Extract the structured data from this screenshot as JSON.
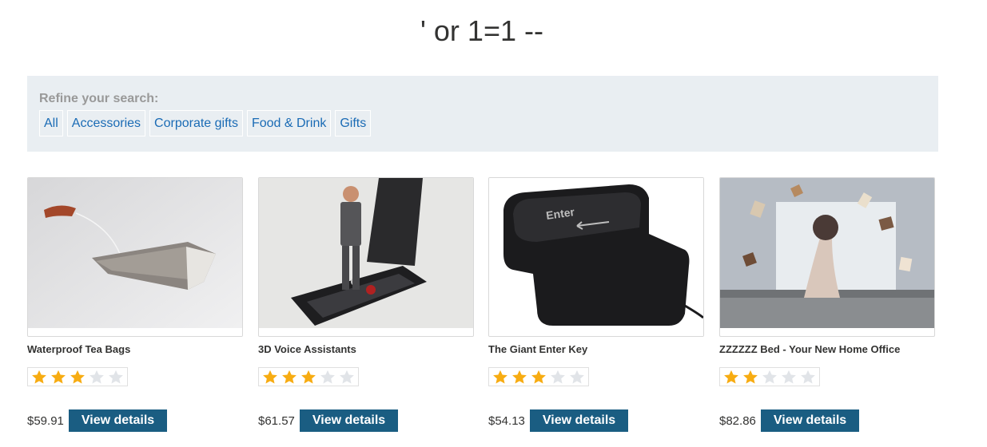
{
  "page": {
    "title": "' or 1=1 --"
  },
  "filters": {
    "label": "Refine your search:",
    "links": [
      "All",
      "Accessories",
      "Corporate gifts",
      "Food & Drink",
      "Gifts"
    ]
  },
  "products": [
    {
      "name": "Waterproof Tea Bags",
      "price": "$59.91",
      "rating": 3,
      "max_rating": 5,
      "button": "View details"
    },
    {
      "name": "3D Voice Assistants",
      "price": "$61.57",
      "rating": 3,
      "max_rating": 5,
      "button": "View details"
    },
    {
      "name": "The Giant Enter Key",
      "price": "$54.13",
      "rating": 3,
      "max_rating": 5,
      "button": "View details"
    },
    {
      "name": "ZZZZZZ Bed - Your New Home Office",
      "price": "$82.86",
      "rating": 2,
      "max_rating": 5,
      "button": "View details"
    }
  ],
  "product_image_text": {
    "enter_key": "Enter"
  },
  "colors": {
    "link": "#1a6bb5",
    "button_bg": "#1a5d82",
    "star_filled": "#f7ac12",
    "star_empty": "#e1e4e8",
    "filter_bg": "#e9eef2"
  }
}
